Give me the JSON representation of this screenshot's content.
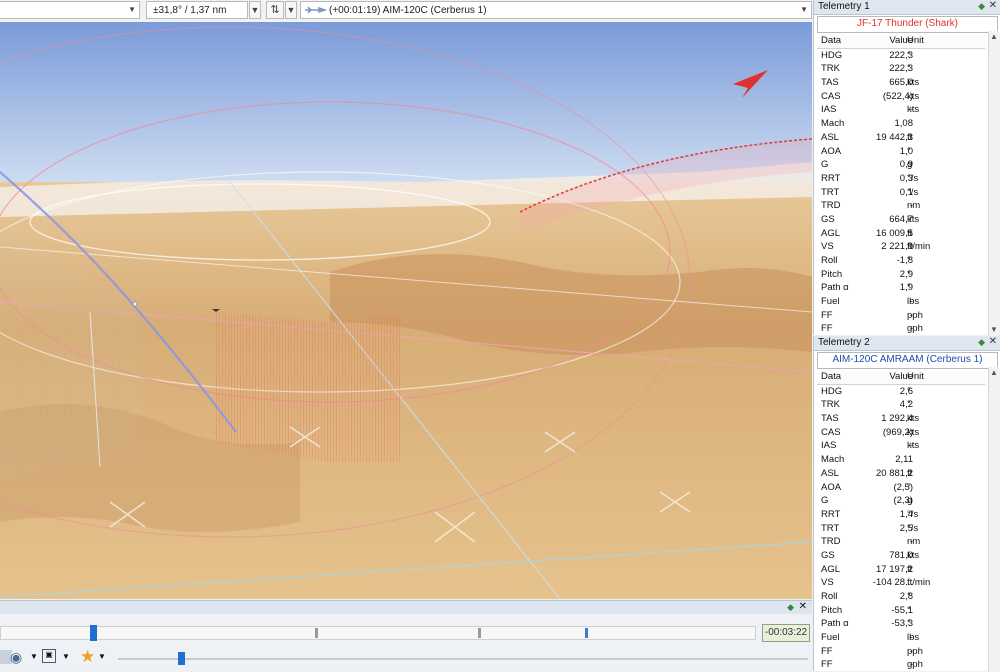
{
  "toolbar": {
    "angle_range": "±31,8° / 1,37 nm",
    "track_label": "(+00:01:19) AIM-120C (Cerberus 1)"
  },
  "colors": {
    "sky_top": "#7a9bd9",
    "sky_bottom": "#cfdcf0",
    "terrain": "#d9b27e",
    "accent_red": "#e0322c",
    "panel_header": "#dfe6ef"
  },
  "timeline": {
    "time": "-00:03:22",
    "playhead_fraction": 0.118
  },
  "telemetry": [
    {
      "panel_title": "Telemetry 1",
      "target": "JF-17 Thunder (Shark)",
      "target_color": "#e0322c",
      "columns": [
        "Data",
        "Value",
        "Unit"
      ],
      "rows": [
        {
          "data": "HDG",
          "value": "222,3",
          "unit": "°"
        },
        {
          "data": "TRK",
          "value": "222,3",
          "unit": "°"
        },
        {
          "data": "TAS",
          "value": "665,0",
          "unit": "kts"
        },
        {
          "data": "CAS",
          "value": "(522,4)",
          "unit": "kts"
        },
        {
          "data": "IAS",
          "value": "-",
          "unit": "kts"
        },
        {
          "data": "Mach",
          "value": "1,08",
          "unit": ""
        },
        {
          "data": "ASL",
          "value": "19 442,3",
          "unit": "ft"
        },
        {
          "data": "AOA",
          "value": "1,0",
          "unit": "°"
        },
        {
          "data": "G",
          "value": "0,9",
          "unit": "g"
        },
        {
          "data": "RRT",
          "value": "0,3",
          "unit": "°/s"
        },
        {
          "data": "TRT",
          "value": "0,1",
          "unit": "°/s"
        },
        {
          "data": "TRD",
          "value": "-",
          "unit": "nm"
        },
        {
          "data": "GS",
          "value": "664,7",
          "unit": "kts"
        },
        {
          "data": "AGL",
          "value": "16 009,5",
          "unit": "ft"
        },
        {
          "data": "VS",
          "value": "2 221,9",
          "unit": "ft/min"
        },
        {
          "data": "Roll",
          "value": "-1,8",
          "unit": "°"
        },
        {
          "data": "Pitch",
          "value": "2,9",
          "unit": "°"
        },
        {
          "data": "Path α",
          "value": "1,9",
          "unit": "°"
        },
        {
          "data": "Fuel",
          "value": "-",
          "unit": "lbs"
        },
        {
          "data": "FF",
          "value": "-",
          "unit": "pph"
        },
        {
          "data": "FF",
          "value": "-",
          "unit": "gph"
        }
      ]
    },
    {
      "panel_title": "Telemetry 2",
      "target": "AIM-120C AMRAAM (Cerberus 1)",
      "target_color": "#1f4fb0",
      "columns": [
        "Data",
        "Value",
        "Unit"
      ],
      "rows": [
        {
          "data": "HDG",
          "value": "2,6",
          "unit": "°"
        },
        {
          "data": "TRK",
          "value": "4,2",
          "unit": "°"
        },
        {
          "data": "TAS",
          "value": "1 292,4",
          "unit": "kts"
        },
        {
          "data": "CAS",
          "value": "(969,2)",
          "unit": "kts"
        },
        {
          "data": "IAS",
          "value": "-",
          "unit": "kts"
        },
        {
          "data": "Mach",
          "value": "2,11",
          "unit": ""
        },
        {
          "data": "ASL",
          "value": "20 881,2",
          "unit": "ft"
        },
        {
          "data": "AOA",
          "value": "(2,5)",
          "unit": "°"
        },
        {
          "data": "G",
          "value": "(2,3)",
          "unit": "g"
        },
        {
          "data": "RRT",
          "value": "1,4",
          "unit": "°/s"
        },
        {
          "data": "TRT",
          "value": "2,5",
          "unit": "°/s"
        },
        {
          "data": "TRD",
          "value": "-",
          "unit": "nm"
        },
        {
          "data": "GS",
          "value": "781,0",
          "unit": "kts"
        },
        {
          "data": "AGL",
          "value": "17 197,2",
          "unit": "ft"
        },
        {
          "data": "VS",
          "value": "-104 28...",
          "unit": "ft/min"
        },
        {
          "data": "Roll",
          "value": "2,8",
          "unit": "°"
        },
        {
          "data": "Pitch",
          "value": "-55,1",
          "unit": "°"
        },
        {
          "data": "Path α",
          "value": "-53,3",
          "unit": "°"
        },
        {
          "data": "Fuel",
          "value": "-",
          "unit": "lbs"
        },
        {
          "data": "FF",
          "value": "-",
          "unit": "pph"
        },
        {
          "data": "FF",
          "value": "-",
          "unit": "gph"
        }
      ]
    }
  ]
}
